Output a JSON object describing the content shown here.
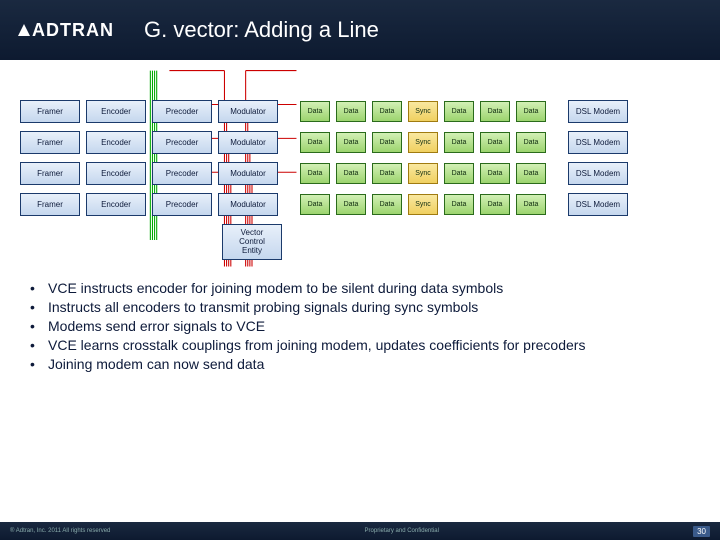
{
  "header": {
    "logo_text": "ADTRAN",
    "title": "G. vector: Adding a Line"
  },
  "diagram": {
    "rows": [
      {
        "boxes": [
          "Framer",
          "Encoder",
          "Precoder",
          "Modulator"
        ],
        "cells": [
          "Data",
          "Data",
          "Data",
          "Sync",
          "Data",
          "Data",
          "Data"
        ],
        "end": "DSL Modem"
      },
      {
        "boxes": [
          "Framer",
          "Encoder",
          "Precoder",
          "Modulator"
        ],
        "cells": [
          "Data",
          "Data",
          "Data",
          "Sync",
          "Data",
          "Data",
          "Data"
        ],
        "end": "DSL Modem"
      },
      {
        "boxes": [
          "Framer",
          "Encoder",
          "Precoder",
          "Modulator"
        ],
        "cells": [
          "Data",
          "Data",
          "Data",
          "Sync",
          "Data",
          "Data",
          "Data"
        ],
        "end": "DSL Modem"
      },
      {
        "boxes": [
          "Framer",
          "Encoder",
          "Precoder",
          "Modulator"
        ],
        "cells": [
          "Data",
          "Data",
          "Data",
          "Sync",
          "Data",
          "Data",
          "Data"
        ],
        "end": "DSL Modem"
      }
    ],
    "vce_lines": [
      "Vector",
      "Control",
      "Entity"
    ]
  },
  "bullets": [
    "VCE instructs encoder for joining modem to be silent during data symbols",
    "Instructs all encoders to transmit probing signals during sync symbols",
    "Modems send error signals to VCE",
    "VCE learns crosstalk couplings from joining modem, updates coefficients for precoders",
    "Joining modem can now send data"
  ],
  "footer": {
    "left": "® Adtran, Inc. 2011 All rights reserved",
    "center": "Proprietary and Confidential",
    "page": "30"
  }
}
